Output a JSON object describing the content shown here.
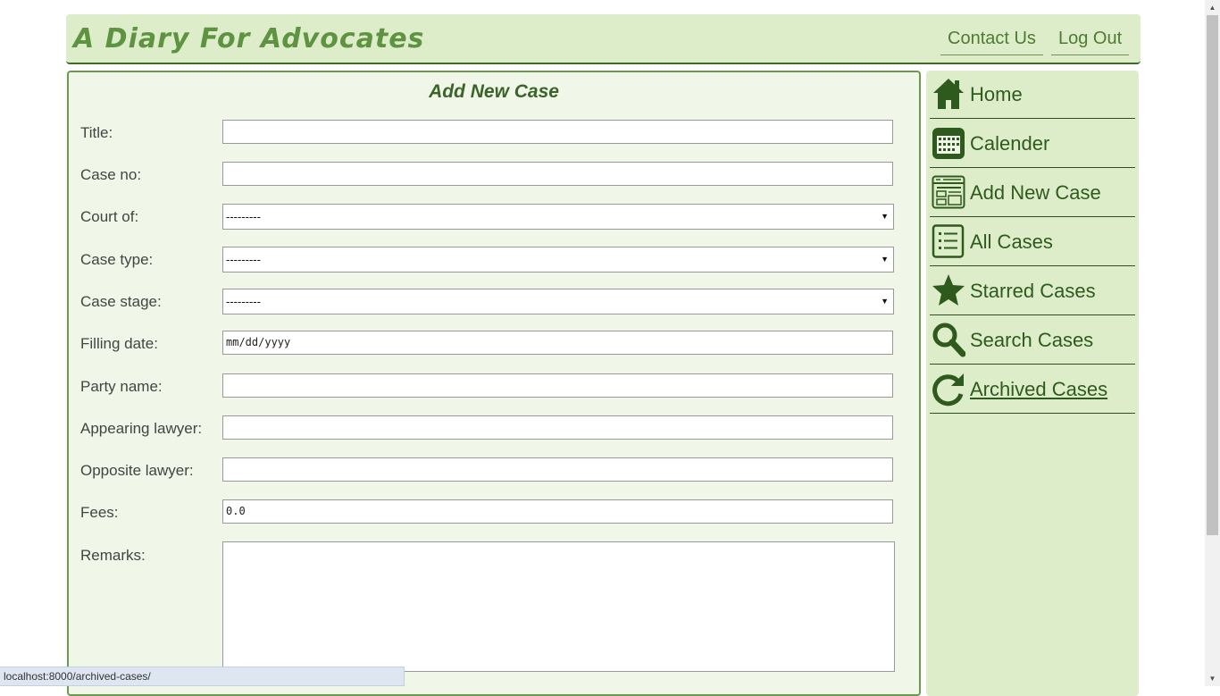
{
  "header": {
    "brand": "A Diary For Advocates",
    "contact_label": "Contact Us",
    "logout_label": "Log Out"
  },
  "form": {
    "title": "Add New Case",
    "fields": {
      "title": {
        "label": "Title:",
        "value": ""
      },
      "case_no": {
        "label": "Case no:",
        "value": ""
      },
      "court_of": {
        "label": "Court of:",
        "value": "---------"
      },
      "case_type": {
        "label": "Case type:",
        "value": "---------"
      },
      "case_stage": {
        "label": "Case stage:",
        "value": "---------"
      },
      "filling_date": {
        "label": "Filling date:",
        "placeholder": "mm/dd/yyyy"
      },
      "party_name": {
        "label": "Party name:",
        "value": ""
      },
      "appearing_lawyer": {
        "label": "Appearing lawyer:",
        "value": ""
      },
      "opposite_lawyer": {
        "label": "Opposite lawyer:",
        "value": ""
      },
      "fees": {
        "label": "Fees:",
        "value": "0.0"
      },
      "remarks": {
        "label": "Remarks:",
        "value": ""
      }
    }
  },
  "sidebar": {
    "items": [
      {
        "label": "Home",
        "icon": "home-icon"
      },
      {
        "label": "Calender",
        "icon": "calendar-icon"
      },
      {
        "label": "Add New Case",
        "icon": "add-case-icon"
      },
      {
        "label": "All Cases",
        "icon": "list-icon"
      },
      {
        "label": "Starred Cases",
        "icon": "star-icon"
      },
      {
        "label": "Search Cases",
        "icon": "search-icon"
      },
      {
        "label": "Archived Cases",
        "icon": "refresh-icon",
        "active": true
      }
    ]
  },
  "status_bar": {
    "url": "localhost:8000/archived-cases/"
  },
  "colors": {
    "accent": "#2f5a1e",
    "header_bg": "#deedc9",
    "panel_bg": "#f0f7e9"
  }
}
